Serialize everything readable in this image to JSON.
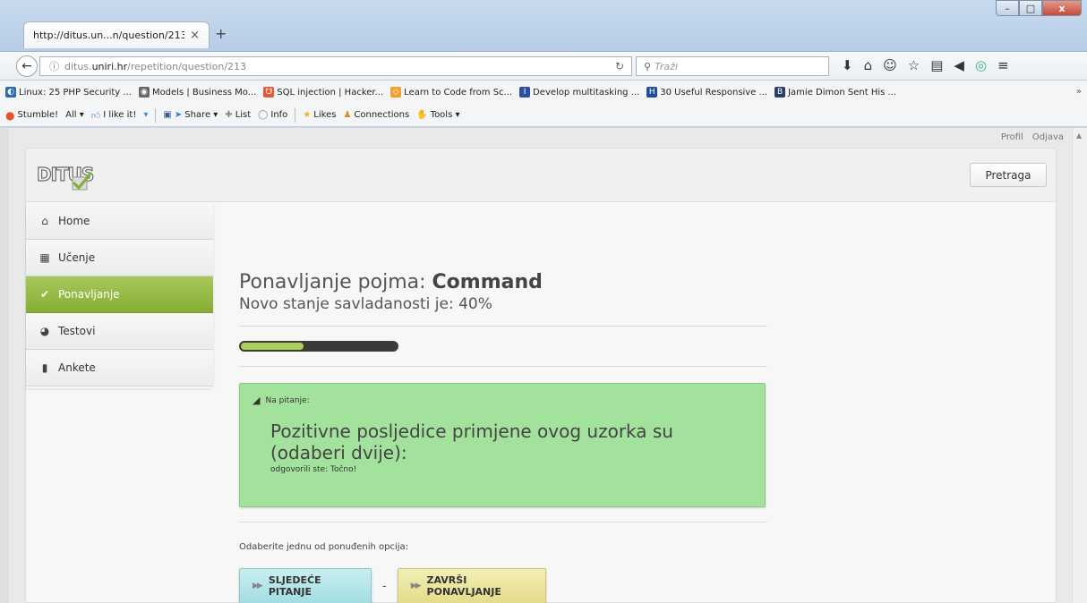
{
  "browser": {
    "tab_title": "http://ditus.un...n/question/213",
    "tab_close": "×",
    "new_tab": "+",
    "url_prefix": "ditus.",
    "url_domain": "uniri.hr",
    "url_path": "/repetition/question/213",
    "search_placeholder": "Traži",
    "win_min": "–",
    "win_max": "□",
    "win_close": "x",
    "bookmarks": [
      {
        "label": "Linux: 25 PHP Security ...",
        "color": "#2b6cb0",
        "glyph": "◐"
      },
      {
        "label": "Models | Business Mo...",
        "color": "#666666",
        "glyph": "◉"
      },
      {
        "label": "SQL injection | Hacker...",
        "color": "#e05a3a",
        "glyph": "☋"
      },
      {
        "label": "Learn to Code from Sc...",
        "color": "#f0a030",
        "glyph": "◇"
      },
      {
        "label": "Develop multitasking ...",
        "color": "#2a4fa0",
        "glyph": "I"
      },
      {
        "label": "30 Useful Responsive ...",
        "color": "#1f4d99",
        "glyph": "H"
      },
      {
        "label": "Jamie Dimon Sent His ...",
        "color": "#2b3f6b",
        "glyph": "B"
      }
    ],
    "bookmarks_more": "»",
    "stumble": {
      "stumble": "Stumble!",
      "all": "All ▾",
      "like": "I like it!",
      "share": "Share ▾",
      "list": "List",
      "info": "Info",
      "likes": "Likes",
      "connections": "Connections",
      "tools": "Tools ▾"
    }
  },
  "top_links": {
    "profile": "Profil",
    "logout": "Odjava"
  },
  "header": {
    "search_button": "Pretraga",
    "logo_text": "DITUS"
  },
  "sidebar": {
    "items": [
      {
        "label": "Home",
        "icon": "home-icon",
        "glyph": "⌂",
        "active": false
      },
      {
        "label": "Učenje",
        "icon": "calendar-icon",
        "glyph": "▦",
        "active": false
      },
      {
        "label": "Ponavljanje",
        "icon": "check-icon",
        "glyph": "✔",
        "active": true
      },
      {
        "label": "Testovi",
        "icon": "pie-chart-icon",
        "glyph": "◕",
        "active": false
      },
      {
        "label": "Ankete",
        "icon": "clipboard-icon",
        "glyph": "▮",
        "active": false
      }
    ]
  },
  "main": {
    "title_prefix": "Ponavljanje pojma: ",
    "title_term": "Command",
    "subtitle": "Novo stanje savladanosti je: 40%",
    "progress_fraction": 0.4,
    "question_label": "Na pitanje:",
    "question_text": "Pozitivne posljedice primjene ovog uzorka su (odaberi dvije):",
    "answer_text": "odgovorili ste: Točno!",
    "choose_text": "Odaberite jednu od ponuđenih opcija:",
    "next_button": "SLJEDEĆE PITANJE",
    "separator": "-",
    "finish_button": "ZAVRŠI PONAVLJANJE"
  },
  "colors": {
    "active_nav": "#95bb45",
    "question_box": "#a3e29c",
    "next_button": "#b6e7ea",
    "finish_button": "#ece59f",
    "progress_fill": "#a6d15a"
  }
}
